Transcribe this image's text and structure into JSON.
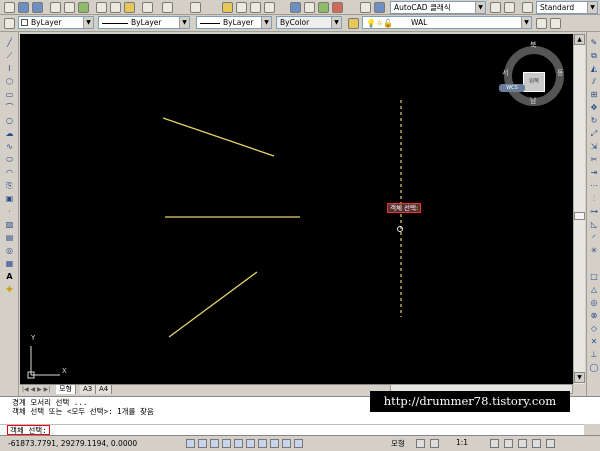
{
  "toolbar1": {
    "workspace": "AutoCAD 클래식",
    "style": "Standard"
  },
  "toolbar2": {
    "layer_color": "ByLayer",
    "linetype": "ByLayer",
    "lineweight": "ByLayer",
    "plotstyle": "ByColor",
    "layer_name": "WAL"
  },
  "viewcube": {
    "north": "북",
    "south": "남",
    "east": "동",
    "west": "서",
    "face": "위쪽",
    "wcs": "WCS"
  },
  "ucs": {
    "x": "X",
    "y": "Y"
  },
  "tooltip": "객체 선택:",
  "tabs": [
    "모형",
    "A3",
    "A4"
  ],
  "command_history": [
    "경계 모서리 선택 ...",
    "객체 선택 또는 <모두 선택>: 1개를 찾음"
  ],
  "prompt": "객체 선택:",
  "watermark": "http://drummer78.tistory.com",
  "status": {
    "coords": "-61873.7791, 29279.1194, 0.0000",
    "model_label": "모형",
    "scale": "1:1"
  },
  "colors": {
    "canvas": "#000000",
    "line": "#e6d36a",
    "accent": "#ee3333"
  },
  "icons": [
    "new-icon",
    "open-icon",
    "save-icon",
    "print-icon",
    "preview-icon",
    "publish-icon",
    "cut-icon",
    "copy-icon",
    "paste-icon",
    "matchprop-icon",
    "undo-icon",
    "redo-icon",
    "pan-icon",
    "zoom-icon",
    "properties-icon",
    "designcenter-icon",
    "toolpalette-icon",
    "help-icon"
  ]
}
